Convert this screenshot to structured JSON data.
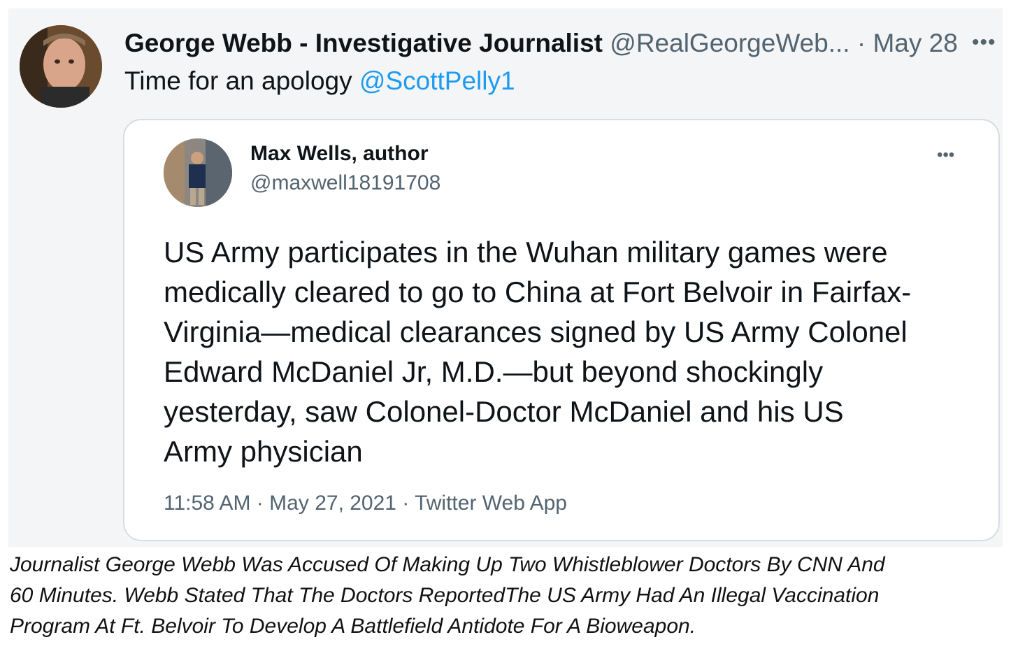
{
  "tweet": {
    "author_name": "George Webb - Investigative Journalist",
    "handle": "@RealGeorgeWeb...",
    "separator": "·",
    "date": "May 28",
    "more": "•••",
    "text_prefix": "Time for an apology ",
    "mention": "@ScottPelly1"
  },
  "quoted_tweet": {
    "author_name": "Max Wells, author",
    "handle": "@maxwell18191708",
    "more": "•••",
    "body_lines": [
      "US Army participates in the Wuhan military games were",
      "medically cleared to go to China at Fort Belvoir in Fairfax-",
      "Virginia—medical clearances signed by US Army Colonel",
      "Edward McDaniel Jr, M.D.—but beyond shockingly",
      "yesterday, saw Colonel-Doctor McDaniel and his US",
      "Army physician"
    ],
    "meta": "11:58 AM · May 27, 2021 · Twitter Web App"
  },
  "caption": {
    "lines": [
      "Journalist George Webb Was Accused Of Making Up Two Whistleblower Doctors By CNN And",
      "60 Minutes.   Webb Stated That The Doctors ReportedThe US Army Had An Illegal Vaccination",
      "Program At Ft. Belvoir To Develop A Battlefield Antidote For A Bioweapon."
    ]
  },
  "colors": {
    "text": "#0f1419",
    "secondary": "#536471",
    "link": "#1d9bf0",
    "border": "#d7dde2"
  }
}
